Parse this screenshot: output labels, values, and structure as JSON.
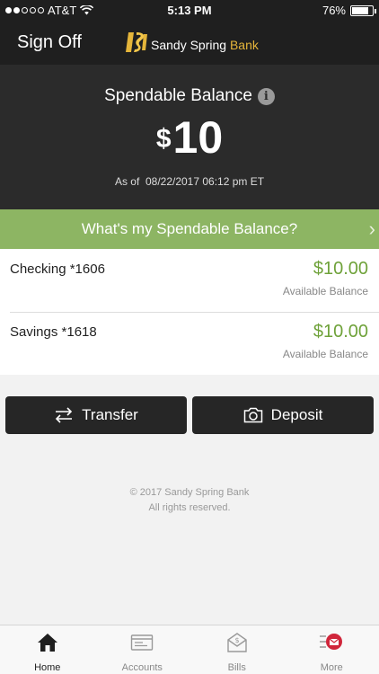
{
  "status_bar": {
    "carrier": "AT&T",
    "time": "5:13 PM",
    "battery": "76%",
    "battery_level": 0.76
  },
  "header": {
    "sign_off_label": "Sign Off",
    "brand_name_primary": "Sandy Spring",
    "brand_name_accent": "Bank",
    "brand_color": "#e5b53a"
  },
  "balance": {
    "title": "Spendable Balance",
    "info_icon": "i",
    "currency": "$",
    "amount": "10",
    "as_of_label": "As of",
    "as_of_value": "08/22/2017 06:12 pm ET"
  },
  "what_bar": {
    "label": "What's my Spendable Balance?",
    "chevron": "›",
    "color": "#8db563"
  },
  "accounts": [
    {
      "name": "Checking *1606",
      "amount": "$10.00",
      "sub": "Available Balance"
    },
    {
      "name": "Savings *1618",
      "amount": "$10.00",
      "sub": "Available Balance"
    }
  ],
  "actions": {
    "transfer_label": "Transfer",
    "deposit_label": "Deposit"
  },
  "footer": {
    "copyright": "© 2017 Sandy Spring Bank",
    "rights": "All rights reserved."
  },
  "tabs": [
    {
      "label": "Home",
      "icon": "home-icon",
      "active": true
    },
    {
      "label": "Accounts",
      "icon": "accounts-icon",
      "active": false
    },
    {
      "label": "Bills",
      "icon": "bills-icon",
      "active": false
    },
    {
      "label": "More",
      "icon": "more-icon",
      "active": false
    }
  ],
  "colors": {
    "accent_green": "#6fa23a",
    "alert_red": "#d0263b"
  }
}
